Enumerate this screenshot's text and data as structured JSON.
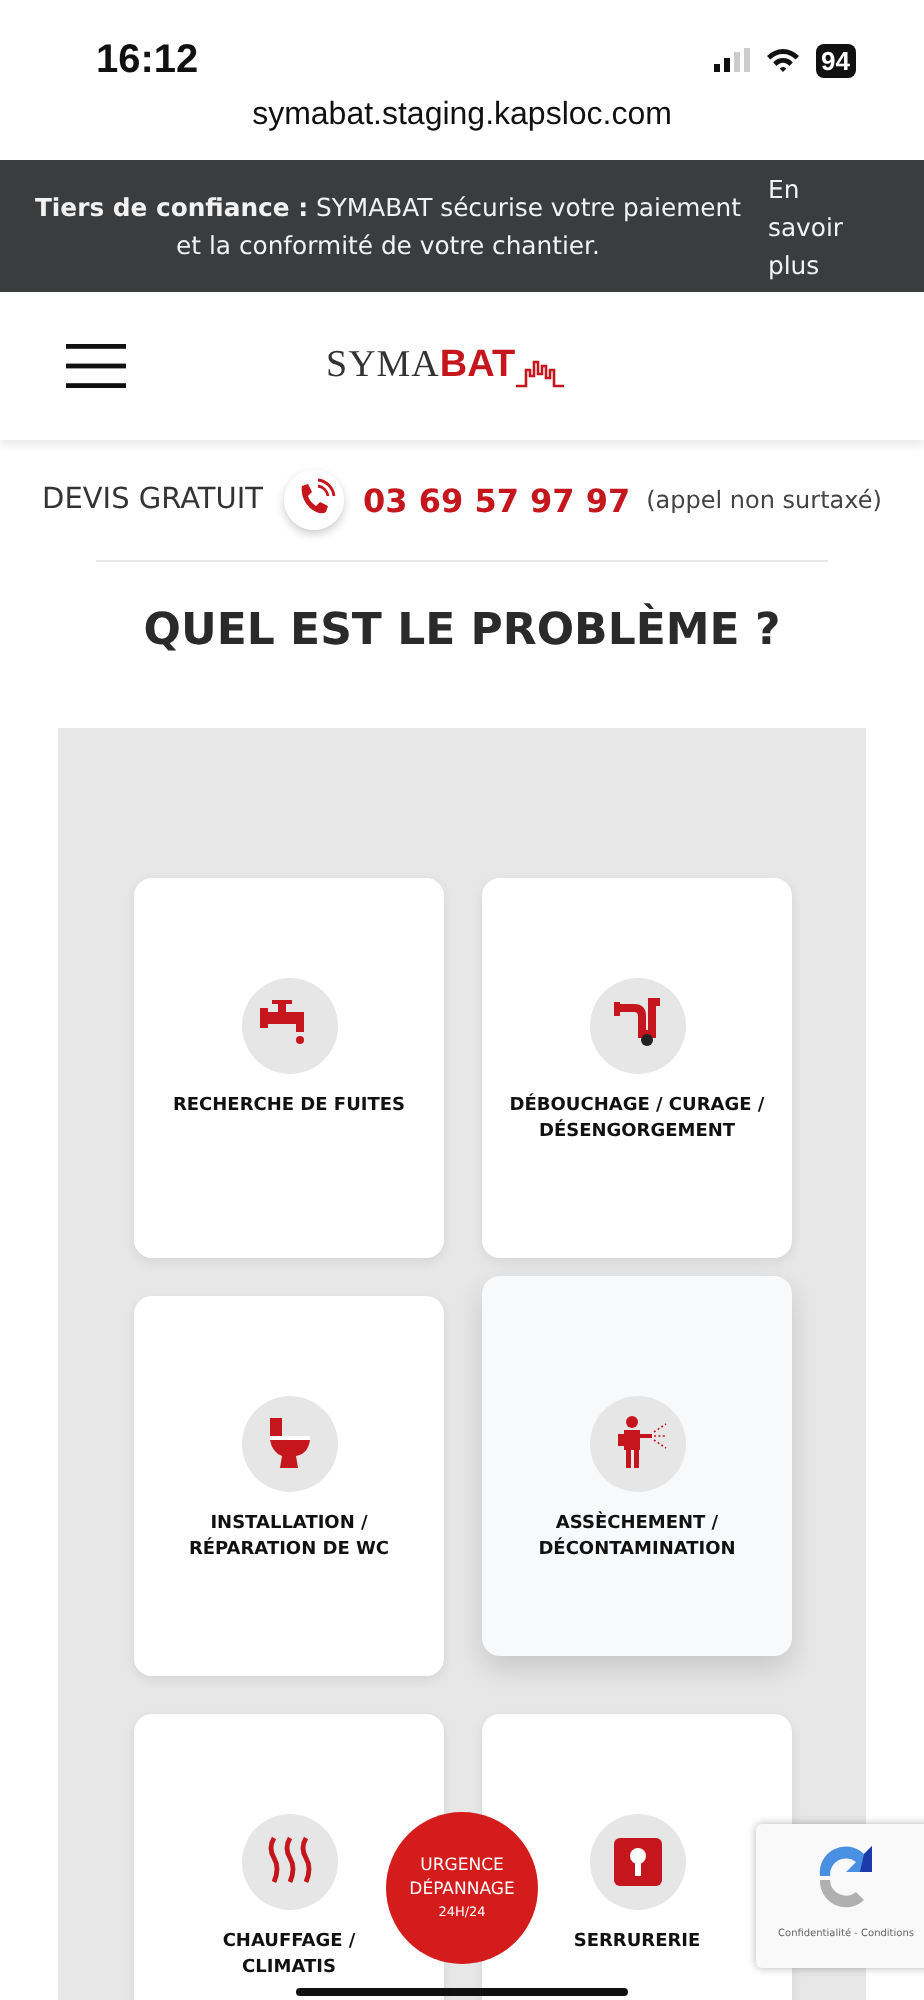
{
  "status_bar": {
    "time": "16:12",
    "battery": "94",
    "url": "symabat.staging.kapsloc.com"
  },
  "banner": {
    "lead": "**Tiers de confiance :** SYMABAT sécurise votre paiement et la conformité de votre chantier.",
    "link": "En savoir plus"
  },
  "header": {
    "logo_plain": "SYMA",
    "logo_bold": "BAT"
  },
  "contact": {
    "label": "DEVIS GRATUIT",
    "phone": "03 69 57 97 97",
    "note": "(appel non surtaxé)"
  },
  "title": "QUEL EST LE PROBLÈME ?",
  "services": [
    {
      "kind": "tap",
      "label": "RECHERCHE DE FUITES",
      "hovered": false
    },
    {
      "kind": "pipe",
      "label": "DÉBOUCHAGE / CURAGE / DÉSENGORGEMENT",
      "hovered": false
    },
    {
      "kind": "toilet",
      "label": "INSTALLATION / RÉPARATION DE WC",
      "hovered": false
    },
    {
      "kind": "sprayer",
      "label": "ASSÈCHEMENT / DÉCONTAMINATION",
      "hovered": true
    },
    {
      "kind": "heat",
      "label": "CHAUFFAGE /\nCLIMATIS",
      "hovered": false
    },
    {
      "kind": "lock",
      "label": "SERRURERIE",
      "hovered": false
    }
  ],
  "emergency_button": {
    "line_1": "URGENCE",
    "line_2": "DÉPANNAGE",
    "line_3": "24H/24"
  },
  "recaptcha": {
    "links": "Confidentialité - Conditions"
  }
}
